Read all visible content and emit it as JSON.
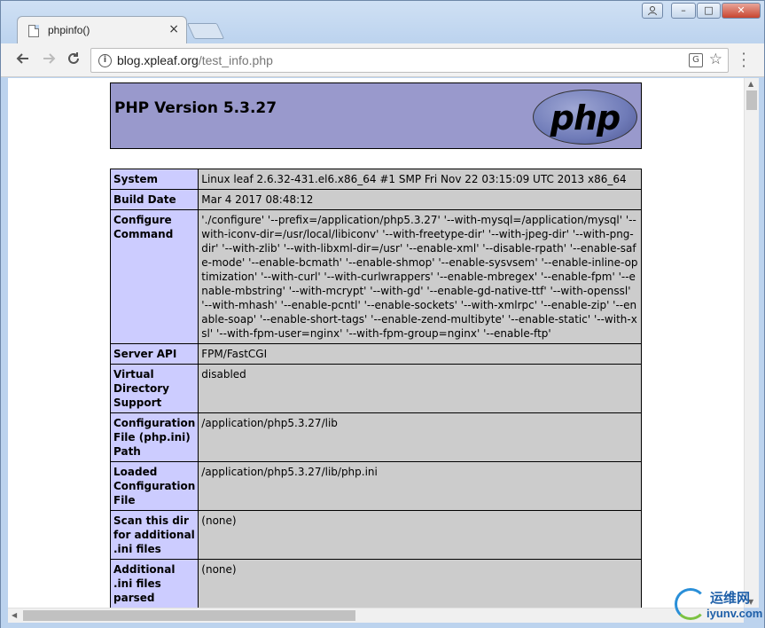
{
  "browser": {
    "tab_title": "phpinfo()",
    "tab_close": "×",
    "url_host": "blog.xpleaf.org",
    "url_path": "/test_info.php",
    "icons": [
      "back-arrow-icon",
      "forward-arrow-icon",
      "reload-icon",
      "info-icon",
      "translate-icon",
      "star-icon",
      "menu-icon"
    ]
  },
  "window": {
    "min": "–",
    "max": "□",
    "close": "✕"
  },
  "phpinfo": {
    "version_title": "PHP Version 5.3.27",
    "logo_text": "php",
    "rows": [
      {
        "key": "System",
        "value": "Linux leaf 2.6.32-431.el6.x86_64 #1 SMP Fri Nov 22 03:15:09 UTC 2013 x86_64"
      },
      {
        "key": "Build Date",
        "value": "Mar 4 2017 08:48:12"
      },
      {
        "key": "Configure Command",
        "value": "'./configure' '--prefix=/application/php5.3.27' '--with-mysql=/application/mysql' '--with-iconv-dir=/usr/local/libiconv' '--with-freetype-dir' '--with-jpeg-dir' '--with-png-dir' '--with-zlib' '--with-libxml-dir=/usr' '--enable-xml' '--disable-rpath' '--enable-safe-mode' '--enable-bcmath' '--enable-shmop' '--enable-sysvsem' '--enable-inline-optimization' '--with-curl' '--with-curlwrappers' '--enable-mbregex' '--enable-fpm' '--enable-mbstring' '--with-mcrypt' '--with-gd' '--enable-gd-native-ttf' '--with-openssl' '--with-mhash' '--enable-pcntl' '--enable-sockets' '--with-xmlrpc' '--enable-zip' '--enable-soap' '--enable-short-tags' '--enable-zend-multibyte' '--enable-static' '--with-xsl' '--with-fpm-user=nginx' '--with-fpm-group=nginx' '--enable-ftp'"
      },
      {
        "key": "Server API",
        "value": "FPM/FastCGI"
      },
      {
        "key": "Virtual Directory Support",
        "value": "disabled"
      },
      {
        "key": "Configuration File (php.ini) Path",
        "value": "/application/php5.3.27/lib"
      },
      {
        "key": "Loaded Configuration File",
        "value": "/application/php5.3.27/lib/php.ini"
      },
      {
        "key": "Scan this dir for additional .ini files",
        "value": "(none)"
      },
      {
        "key": "Additional .ini files parsed",
        "value": "(none)"
      }
    ]
  },
  "watermark": {
    "cn": "运维网",
    "url": "iyunv.com"
  }
}
